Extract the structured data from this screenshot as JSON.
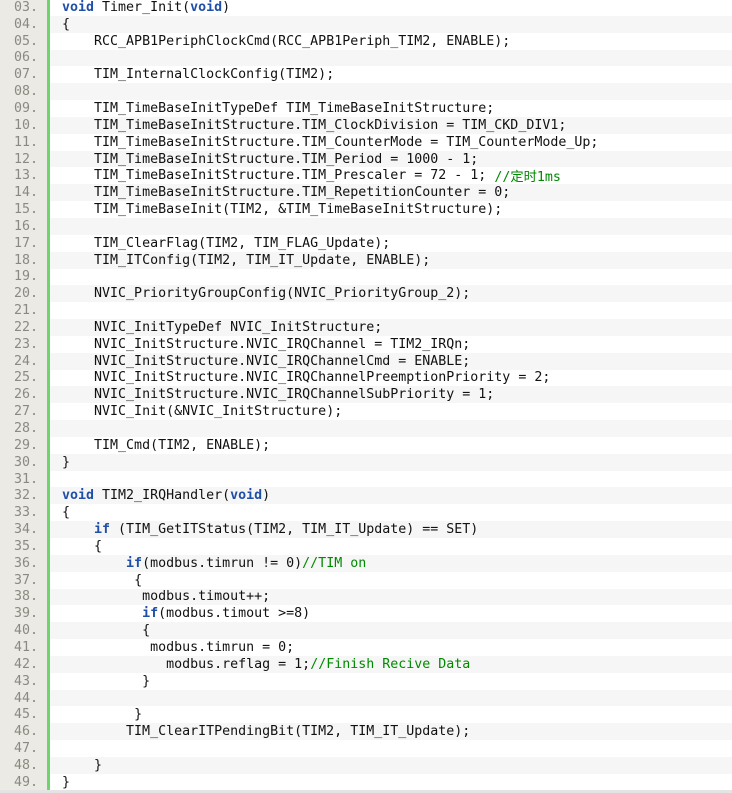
{
  "colors": {
    "keyword": "#1f4fa6",
    "comment": "#008a00",
    "gutter": "#ebeae4",
    "gutter_border": "#6cd66c",
    "alt_row": "#f6f6f6"
  },
  "lines": [
    {
      "n": "03.",
      "i": 0,
      "t": [
        [
          "void",
          "kw"
        ],
        [
          " Timer_Init(",
          ""
        ],
        [
          "void",
          "kw"
        ],
        [
          ")",
          ""
        ]
      ]
    },
    {
      "n": "04.",
      "i": 0,
      "t": [
        [
          "{",
          ""
        ]
      ]
    },
    {
      "n": "05.",
      "i": 4,
      "t": [
        [
          "RCC_APB1PeriphClockCmd(RCC_APB1Periph_TIM2, ENABLE);",
          ""
        ]
      ]
    },
    {
      "n": "06.",
      "i": 0,
      "t": []
    },
    {
      "n": "07.",
      "i": 4,
      "t": [
        [
          "TIM_InternalClockConfig(TIM2);",
          ""
        ]
      ]
    },
    {
      "n": "08.",
      "i": 0,
      "t": []
    },
    {
      "n": "09.",
      "i": 4,
      "t": [
        [
          "TIM_TimeBaseInitTypeDef TIM_TimeBaseInitStructure;",
          ""
        ]
      ]
    },
    {
      "n": "10.",
      "i": 4,
      "t": [
        [
          "TIM_TimeBaseInitStructure.TIM_ClockDivision = TIM_CKD_DIV1;",
          ""
        ]
      ]
    },
    {
      "n": "11.",
      "i": 4,
      "t": [
        [
          "TIM_TimeBaseInitStructure.TIM_CounterMode = TIM_CounterMode_Up;",
          ""
        ]
      ]
    },
    {
      "n": "12.",
      "i": 4,
      "t": [
        [
          "TIM_TimeBaseInitStructure.TIM_Period = 1000 - 1;",
          ""
        ]
      ]
    },
    {
      "n": "13.",
      "i": 4,
      "t": [
        [
          "TIM_TimeBaseInitStructure.TIM_Prescaler = 72 - 1; ",
          ""
        ],
        [
          "//定时1ms",
          "cm"
        ]
      ]
    },
    {
      "n": "14.",
      "i": 4,
      "t": [
        [
          "TIM_TimeBaseInitStructure.TIM_RepetitionCounter = 0;",
          ""
        ]
      ]
    },
    {
      "n": "15.",
      "i": 4,
      "t": [
        [
          "TIM_TimeBaseInit(TIM2, &TIM_TimeBaseInitStructure);",
          ""
        ]
      ]
    },
    {
      "n": "16.",
      "i": 0,
      "t": []
    },
    {
      "n": "17.",
      "i": 4,
      "t": [
        [
          "TIM_ClearFlag(TIM2, TIM_FLAG_Update);",
          ""
        ]
      ]
    },
    {
      "n": "18.",
      "i": 4,
      "t": [
        [
          "TIM_ITConfig(TIM2, TIM_IT_Update, ENABLE);",
          ""
        ]
      ]
    },
    {
      "n": "19.",
      "i": 0,
      "t": []
    },
    {
      "n": "20.",
      "i": 4,
      "t": [
        [
          "NVIC_PriorityGroupConfig(NVIC_PriorityGroup_2);",
          ""
        ]
      ]
    },
    {
      "n": "21.",
      "i": 0,
      "t": []
    },
    {
      "n": "22.",
      "i": 4,
      "t": [
        [
          "NVIC_InitTypeDef NVIC_InitStructure;",
          ""
        ]
      ]
    },
    {
      "n": "23.",
      "i": 4,
      "t": [
        [
          "NVIC_InitStructure.NVIC_IRQChannel = TIM2_IRQn;",
          ""
        ]
      ]
    },
    {
      "n": "24.",
      "i": 4,
      "t": [
        [
          "NVIC_InitStructure.NVIC_IRQChannelCmd = ENABLE;",
          ""
        ]
      ]
    },
    {
      "n": "25.",
      "i": 4,
      "t": [
        [
          "NVIC_InitStructure.NVIC_IRQChannelPreemptionPriority = 2;",
          ""
        ]
      ]
    },
    {
      "n": "26.",
      "i": 4,
      "t": [
        [
          "NVIC_InitStructure.NVIC_IRQChannelSubPriority = 1;",
          ""
        ]
      ]
    },
    {
      "n": "27.",
      "i": 4,
      "t": [
        [
          "NVIC_Init(&NVIC_InitStructure);",
          ""
        ]
      ]
    },
    {
      "n": "28.",
      "i": 0,
      "t": []
    },
    {
      "n": "29.",
      "i": 4,
      "t": [
        [
          "TIM_Cmd(TIM2, ENABLE);",
          ""
        ]
      ]
    },
    {
      "n": "30.",
      "i": 0,
      "t": [
        [
          "}",
          ""
        ]
      ]
    },
    {
      "n": "31.",
      "i": 0,
      "t": []
    },
    {
      "n": "32.",
      "i": 0,
      "t": [
        [
          "void",
          "kw"
        ],
        [
          " TIM2_IRQHandler(",
          ""
        ],
        [
          "void",
          "kw"
        ],
        [
          ")",
          ""
        ]
      ]
    },
    {
      "n": "33.",
      "i": 0,
      "t": [
        [
          "{",
          ""
        ]
      ]
    },
    {
      "n": "34.",
      "i": 4,
      "t": [
        [
          "if",
          "kw"
        ],
        [
          " (TIM_GetITStatus(TIM2, TIM_IT_Update) == SET)",
          ""
        ]
      ]
    },
    {
      "n": "35.",
      "i": 4,
      "t": [
        [
          "{",
          ""
        ]
      ]
    },
    {
      "n": "36.",
      "i": 8,
      "t": [
        [
          "if",
          "kw"
        ],
        [
          "(modbus.timrun != 0)",
          ""
        ],
        [
          "//TIM on",
          "cm"
        ]
      ]
    },
    {
      "n": "37.",
      "i": 9,
      "t": [
        [
          "{",
          ""
        ]
      ]
    },
    {
      "n": "38.",
      "i": 10,
      "t": [
        [
          "modbus.timout++;",
          ""
        ]
      ]
    },
    {
      "n": "39.",
      "i": 10,
      "t": [
        [
          "if",
          "kw"
        ],
        [
          "(modbus.timout >=8)",
          ""
        ]
      ]
    },
    {
      "n": "40.",
      "i": 10,
      "t": [
        [
          "{",
          ""
        ]
      ]
    },
    {
      "n": "41.",
      "i": 11,
      "t": [
        [
          "modbus.timrun = 0;",
          ""
        ]
      ]
    },
    {
      "n": "42.",
      "i": 13,
      "t": [
        [
          "modbus.reflag = 1;",
          ""
        ],
        [
          "//Finish Recive Data",
          "cm"
        ]
      ]
    },
    {
      "n": "43.",
      "i": 10,
      "t": [
        [
          "}",
          ""
        ]
      ]
    },
    {
      "n": "44.",
      "i": 0,
      "t": []
    },
    {
      "n": "45.",
      "i": 9,
      "t": [
        [
          "}",
          ""
        ]
      ]
    },
    {
      "n": "46.",
      "i": 8,
      "t": [
        [
          "TIM_ClearITPendingBit(TIM2, TIM_IT_Update);",
          ""
        ]
      ]
    },
    {
      "n": "47.",
      "i": 0,
      "t": []
    },
    {
      "n": "48.",
      "i": 4,
      "t": [
        [
          "}",
          ""
        ]
      ]
    },
    {
      "n": "49.",
      "i": 0,
      "t": [
        [
          "}",
          ""
        ]
      ]
    }
  ]
}
